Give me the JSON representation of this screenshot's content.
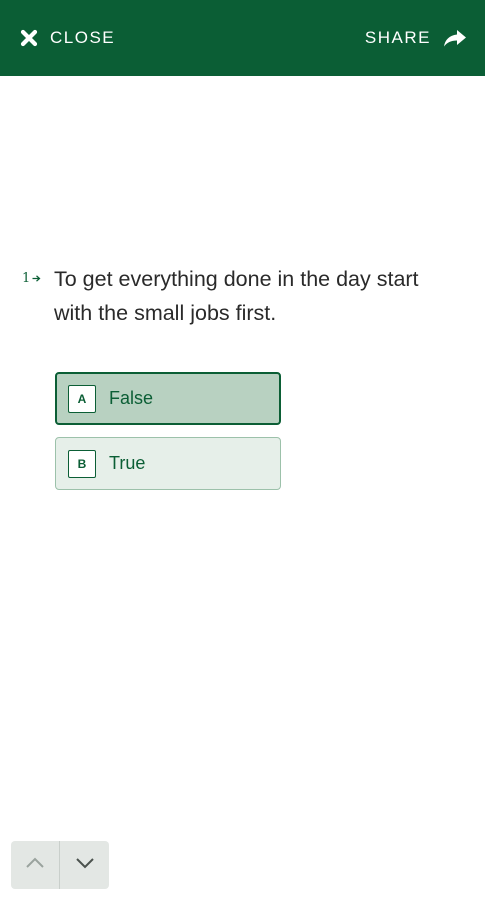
{
  "header": {
    "close_label": "CLOSE",
    "share_label": "SHARE",
    "close_icon": "x-cross-icon",
    "share_icon": "share-arrow-icon",
    "background_color": "#0b5e35"
  },
  "question": {
    "number": "1",
    "text": "To get everything done in the day start with the small jobs first."
  },
  "choices": [
    {
      "key": "A",
      "label": "False",
      "selected": true
    },
    {
      "key": "B",
      "label": "True",
      "selected": false
    }
  ],
  "nav": {
    "up_icon": "chevron-up-icon",
    "down_icon": "chevron-down-icon"
  }
}
